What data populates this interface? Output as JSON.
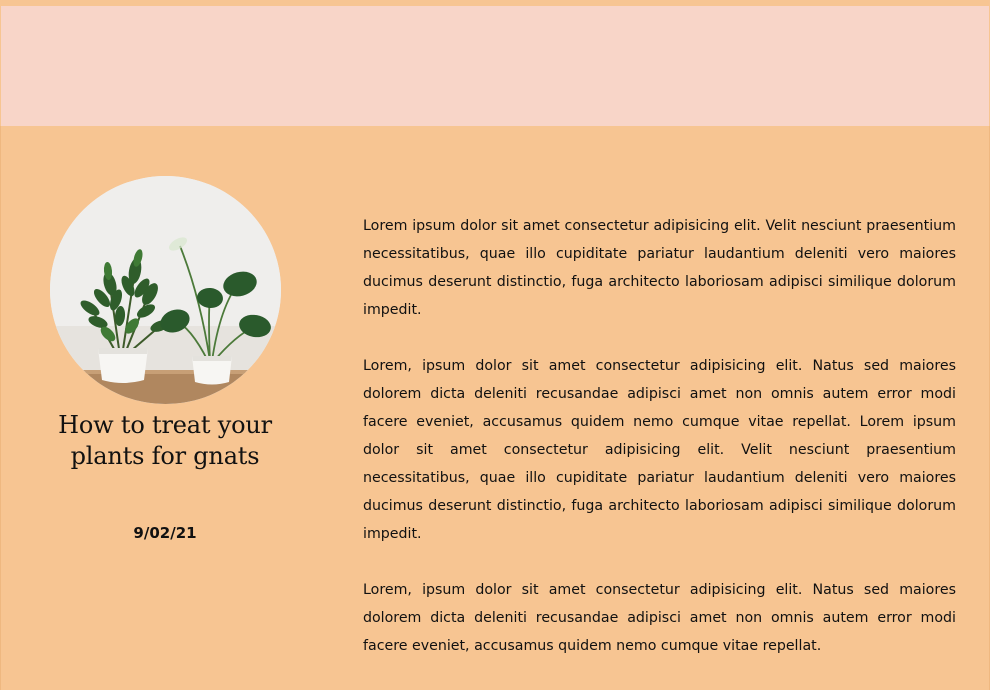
{
  "post": {
    "title": "How to treat your plants for gnats",
    "date": "9/02/21"
  },
  "article": {
    "paragraphs": [
      "Lorem ipsum dolor sit amet consectetur adipisicing elit. Velit nesciunt praesentium necessitatibus, quae illo cupiditate pariatur laudantium deleniti vero maiores ducimus deserunt distinctio, fuga architecto laboriosam adipisci similique dolorum impedit.",
      "Lorem, ipsum dolor sit amet consectetur adipisicing elit. Natus sed maiores dolorem dicta deleniti recusandae adipisci amet non omnis autem error modi facere eveniet, accusamus quidem nemo cumque vitae repellat. Lorem ipsum dolor sit amet consectetur adipisicing elit. Velit nesciunt praesentium necessitatibus, quae illo cupiditate pariatur laudantium deleniti vero maiores ducimus deserunt distinctio, fuga architecto laboriosam adipisci similique dolorum impedit.",
      "Lorem, ipsum dolor sit amet consectetur adipisicing elit. Natus sed maiores dolorem dicta deleniti recusandae adipisci amet non omnis autem error modi facere eveniet, accusamus quidem nemo cumque vitae repellat."
    ]
  },
  "colors": {
    "page_background": "#f7c592",
    "header_band": "#f8d5c8",
    "text": "#111111"
  }
}
